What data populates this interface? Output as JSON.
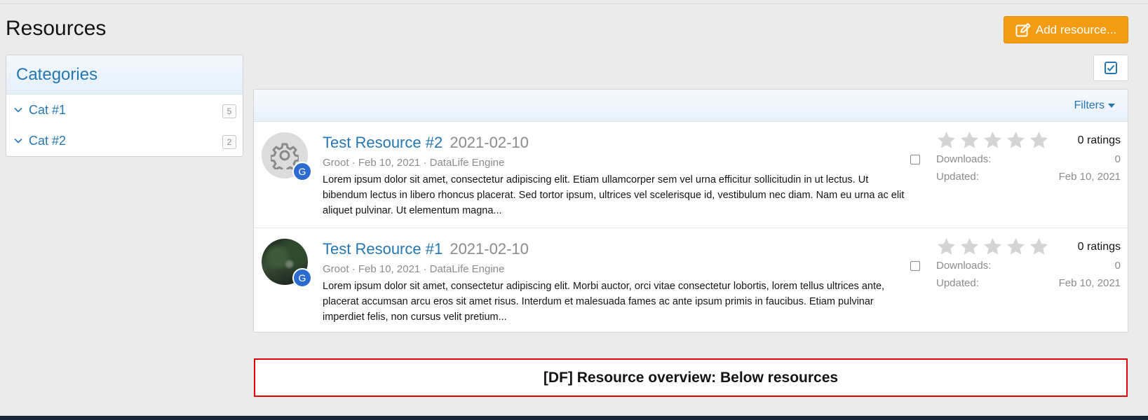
{
  "page": {
    "title": "Resources",
    "add_button": "Add resource..."
  },
  "sidebar": {
    "heading": "Categories",
    "items": [
      {
        "label": "Cat #1",
        "count": "5"
      },
      {
        "label": "Cat #2",
        "count": "2"
      }
    ]
  },
  "list": {
    "filters_label": "Filters",
    "resources": [
      {
        "title": "Test Resource #2",
        "version": "2021-02-10",
        "author": "Groot",
        "date": "Feb 10, 2021",
        "category": "DataLife Engine",
        "description": "Lorem ipsum dolor sit amet, consectetur adipiscing elit. Etiam ullamcorper sem vel urna efficitur sollicitudin in ut lectus. Ut bibendum lectus in libero rhoncus placerat. Sed tortor ipsum, ultrices vel scelerisque id, vestibulum nec diam. Nam eu urna ac elit aliquet pulvinar. Ut elementum magna...",
        "avatar_letter": "G",
        "ratings": "0 ratings",
        "downloads_label": "Downloads:",
        "downloads": "0",
        "updated_label": "Updated:",
        "updated": "Feb 10, 2021",
        "rating_value": 0
      },
      {
        "title": "Test Resource #1",
        "version": "2021-02-10",
        "author": "Groot",
        "date": "Feb 10, 2021",
        "category": "DataLife Engine",
        "description": "Lorem ipsum dolor sit amet, consectetur adipiscing elit. Morbi auctor, orci vitae consectetur lobortis, lorem tellus ultrices ante, placerat accumsan arcu eros sit amet risus. Interdum et malesuada fames ac ante ipsum primis in faucibus. Etiam pulvinar imperdiet felis, non cursus velit pretium...",
        "avatar_letter": "G",
        "ratings": "0 ratings",
        "downloads_label": "Downloads:",
        "downloads": "0",
        "updated_label": "Updated:",
        "updated": "Feb 10, 2021",
        "rating_value": 0
      }
    ]
  },
  "below": {
    "label": "[DF] Resource overview: Below resources"
  },
  "colors": {
    "accent": "#2577b1",
    "button": "#f39c12",
    "border_highlight": "#e00000",
    "star_empty": "#d4d4d4"
  },
  "icons": {
    "add": "edit-icon",
    "select": "checkbox-icon",
    "category": "chevron-down-icon",
    "rating": "star-icon",
    "filters": "caret-down-icon",
    "default_avatar": "gear-icon"
  }
}
